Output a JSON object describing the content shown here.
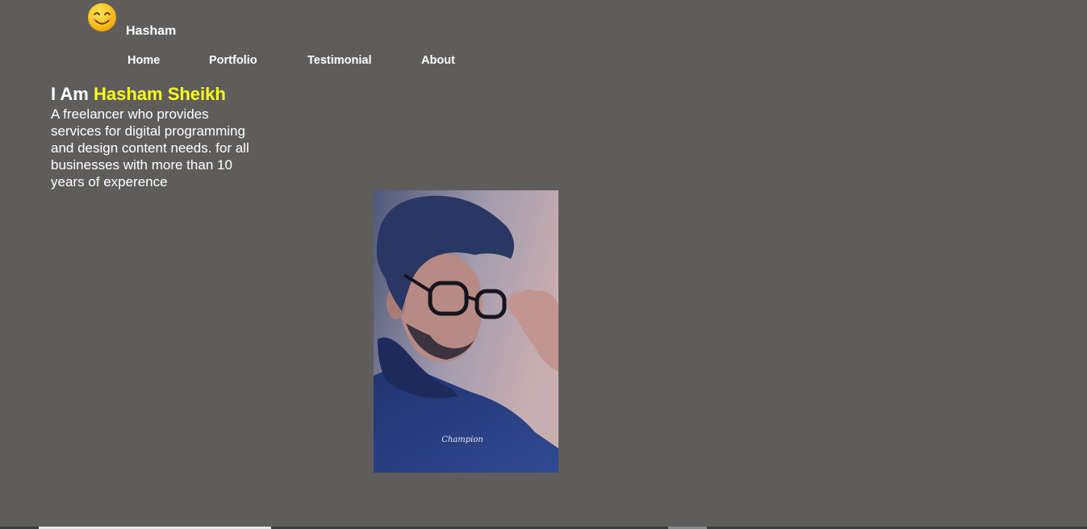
{
  "brand": {
    "name": "Hasham",
    "logo_icon": "smiling-face-icon"
  },
  "nav": {
    "items": [
      {
        "label": "Home"
      },
      {
        "label": "Portfolio"
      },
      {
        "label": "Testimonial"
      },
      {
        "label": "About"
      }
    ]
  },
  "hero": {
    "heading_prefix": "I Am ",
    "heading_name": "Hasham Sheikh",
    "description": "A freelancer who provides services for digital programming and design content needs. for all businesses with more than 10 years of experence",
    "photo_shirt_text": "Champion"
  },
  "colors": {
    "background": "#5e5d5c",
    "text": "#ffffff",
    "highlight": "#ffff1a"
  }
}
